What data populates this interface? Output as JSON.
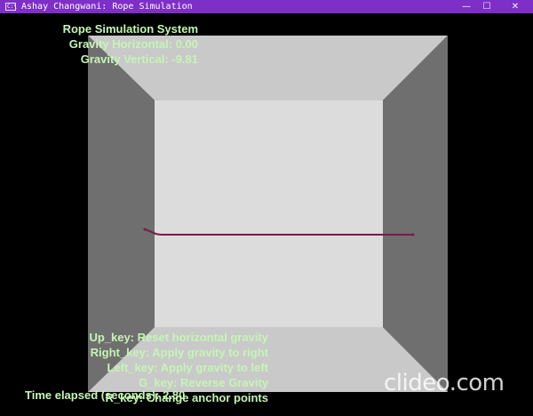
{
  "window": {
    "title": "Ashay Changwani: Rope Simulation",
    "app_icon_glyph": "C:\\",
    "minimize_glyph": "—",
    "maximize_glyph": "☐",
    "close_glyph": "✕",
    "titlebar_color": "#7d2fc7"
  },
  "hud": {
    "title": "Rope Simulation System",
    "gravity_horizontal": "Gravity Horizontal: 0.00",
    "gravity_vertical": "Gravity Vertical: -9.81",
    "controls": [
      "Up_key: Reset horizontal gravity",
      "Right_key: Apply gravity to right",
      "Left_key: Apply gravity to left",
      "G_key: Reverse Gravity",
      "R_key: Change anchor points"
    ],
    "time_elapsed": "Time elapsed (seconds): 2.80",
    "text_color": "#c5f5b5"
  },
  "scene": {
    "room_colors": {
      "back_wall": "#dcdcdc",
      "ceiling": "#c9c9c9",
      "floor": "#c9c9c9",
      "side_walls": "#6f6f6f"
    },
    "rope_color": "#7a1a4a"
  },
  "watermark": {
    "text": "clideo.com"
  }
}
